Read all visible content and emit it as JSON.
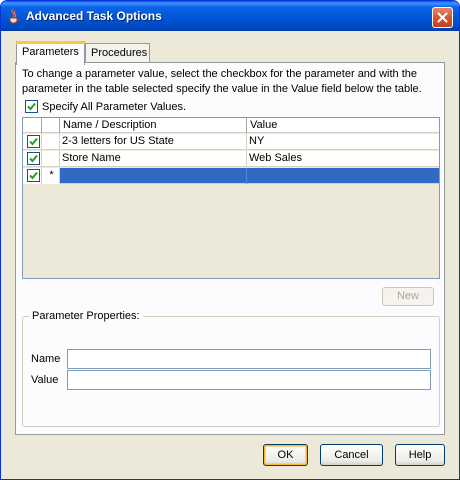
{
  "window": {
    "title": "Advanced Task Options"
  },
  "tabs": [
    {
      "label": "Parameters",
      "active": true
    },
    {
      "label": "Procedures",
      "active": false
    }
  ],
  "parameters": {
    "description": "To change a parameter value, select the checkbox for the parameter and with the parameter in the table selected specify the value in the Value field below the table.",
    "specify_all_label": "Specify All Parameter Values.",
    "specify_all_checked": true,
    "table": {
      "columns": [
        "Name / Description",
        "Value"
      ],
      "rows": [
        {
          "checked": true,
          "marker": "",
          "name": "2-3 letters for US State",
          "value": "NY",
          "selected": false
        },
        {
          "checked": true,
          "marker": "",
          "name": "Store Name",
          "value": "Web Sales",
          "selected": false
        },
        {
          "checked": true,
          "marker": "*",
          "name": "",
          "value": "",
          "selected": true
        }
      ]
    },
    "new_button": "New",
    "properties": {
      "legend": "Parameter Properties:",
      "name_label": "Name",
      "name_value": "",
      "value_label": "Value",
      "value_value": ""
    }
  },
  "buttons": {
    "ok": "OK",
    "cancel": "Cancel",
    "help": "Help"
  },
  "colors": {
    "title_bar": "#0055d4",
    "selection": "#316ac5",
    "check": "#21a121",
    "close_button": "#d9552f"
  }
}
